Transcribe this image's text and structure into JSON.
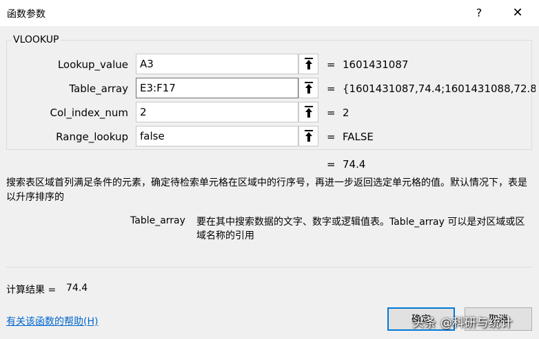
{
  "dialog": {
    "title": "函数参数",
    "help_symbol": "?",
    "close_symbol": "✕"
  },
  "function_name": "VLOOKUP",
  "arguments": [
    {
      "label": "Lookup_value",
      "value": "A3",
      "result": "1601431087"
    },
    {
      "label": "Table_array",
      "value": "E3:F17",
      "result": "{1601431087,74.4;1601431088,72.8;"
    },
    {
      "label": "Col_index_num",
      "value": "2",
      "result": "2"
    },
    {
      "label": "Range_lookup",
      "value": "false",
      "result": "FALSE"
    }
  ],
  "equals": "=",
  "function_result": "74.4",
  "description": "搜索表区域首列满足条件的元素，确定待检索单元格在区域中的行序号，再进一步返回选定单元格的值。默认情况下，表是以升序排序的",
  "current_arg": {
    "name": "Table_array",
    "description": "要在其中搜索数据的文字、数字或逻辑值表。Table_array 可以是对区域或区域名称的引用"
  },
  "calculation": {
    "label": "计算结果 =",
    "value": "74.4"
  },
  "help_link": "有关该函数的帮助(H)",
  "buttons": {
    "ok": "确定",
    "cancel": "取消"
  },
  "watermark": "头条 @科研与统计",
  "icons": {
    "ref_collapse": "collapse-range-icon"
  }
}
